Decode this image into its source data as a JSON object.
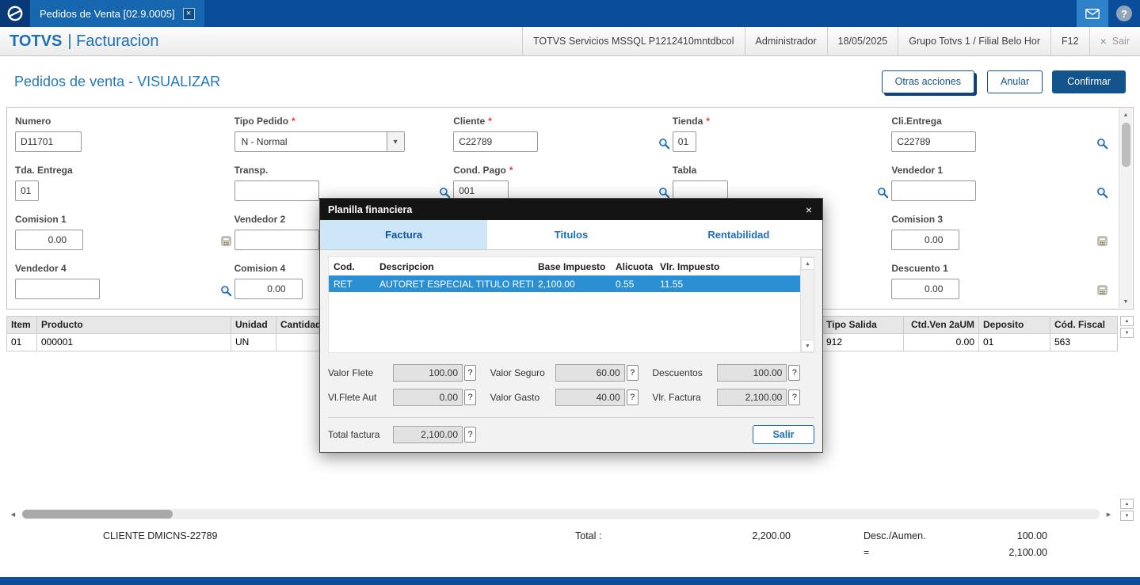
{
  "icons": {
    "close": "×",
    "help": "?",
    "up_arrow": "▲",
    "down_arrow": "▼",
    "left_arrow": "◀",
    "right_arrow": "▶",
    "select_chevron": "▾"
  },
  "topbar": {
    "tab_title": "Pedidos de Venta [02.9.0005]"
  },
  "header": {
    "brand_name": "TOTVS",
    "brand_module": "| Facturacion",
    "cells": [
      {
        "label": "TOTVS Servicios MSSQL P1212410mntdbcol"
      },
      {
        "label": "Administrador"
      },
      {
        "label": "18/05/2025"
      },
      {
        "label": "Grupo Totvs 1 / Filial Belo Hor"
      },
      {
        "label": "F12"
      }
    ],
    "exit_label": "Sair"
  },
  "page": {
    "title": "Pedidos de venta - VISUALIZAR",
    "buttons": {
      "other_actions": "Otras acciones",
      "anular": "Anular",
      "confirmar": "Confirmar"
    }
  },
  "form": {
    "required_mark": "*",
    "numero": {
      "label": "Numero",
      "value": "D11701"
    },
    "tipo_pedido": {
      "label": "Tipo Pedido",
      "value": "N - Normal"
    },
    "cliente": {
      "label": "Cliente",
      "value": "C22789"
    },
    "tienda": {
      "label": "Tienda",
      "value": "01"
    },
    "cli_entrega": {
      "label": "Cli.Entrega",
      "value": "C22789"
    },
    "tda_entrega": {
      "label": "Tda. Entrega",
      "value": "01"
    },
    "transp": {
      "label": "Transp.",
      "value": ""
    },
    "cond_pago": {
      "label": "Cond. Pago",
      "value": "001"
    },
    "tabla": {
      "label": "Tabla",
      "value": ""
    },
    "vendedor1": {
      "label": "Vendedor 1",
      "value": ""
    },
    "comision1": {
      "label": "Comision 1",
      "value": "0.00"
    },
    "vendedor2": {
      "label": "Vendedor 2",
      "value": ""
    },
    "comision3": {
      "label": "Comision 3",
      "value": "0.00"
    },
    "vendedor4": {
      "label": "Vendedor 4",
      "value": ""
    },
    "comision4": {
      "label": "Comision 4",
      "value": "0.00"
    },
    "descuento1": {
      "label": "Descuento 1",
      "value": "0.00"
    }
  },
  "items_grid": {
    "headers": {
      "item": "Item",
      "producto": "Producto",
      "unidad": "Unidad",
      "cantidad": "Cantidad",
      "tipo_salida": "Tipo Salida",
      "ctd_ven": "Ctd.Ven 2aUM",
      "deposito": "Deposito",
      "cod_fiscal": "Cód. Fiscal"
    },
    "row": {
      "item": "01",
      "producto": "000001",
      "unidad": "UN",
      "tipo_salida": "912",
      "ctd_ven": "0.00",
      "deposito": "01",
      "cod_fiscal": "563"
    }
  },
  "modal": {
    "title": "Planilla financiera",
    "tabs": [
      {
        "label": "Factura"
      },
      {
        "label": "Titulos"
      },
      {
        "label": "Rentabilidad"
      }
    ],
    "table": {
      "headers": [
        "Cod.",
        "Descripcion",
        "Base Impuesto",
        "Alicuota",
        "Vlr. Impuesto"
      ],
      "row": [
        "RET",
        "AUTORET ESPECIAL TITULO RETEN",
        "2,100.00",
        "0.55",
        "11.55"
      ]
    },
    "fields": [
      {
        "label": "Valor Flete",
        "value": "100.00"
      },
      {
        "label": "Valor Seguro",
        "value": "60.00"
      },
      {
        "label": "Descuentos",
        "value": "100.00"
      },
      {
        "label": "Vl.Flete Aut",
        "value": "0.00"
      },
      {
        "label": "Valor Gasto",
        "value": "40.00"
      },
      {
        "label": "Vlr. Factura",
        "value": "2,100.00"
      }
    ],
    "total": {
      "label": "Total factura",
      "value": "2,100.00"
    },
    "exit_button": "Salir"
  },
  "footer": {
    "client": "CLIENTE DMICNS-22789",
    "total_label": "Total :",
    "total_value": "2,200.00",
    "desc_label": "Desc./Aumen.",
    "desc_value": "100.00",
    "equals": "=",
    "net_value": "2,100.00"
  }
}
